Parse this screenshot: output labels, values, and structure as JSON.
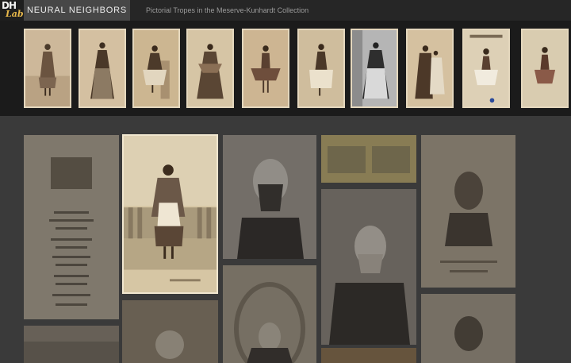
{
  "header": {
    "logo_line1": "DH",
    "logo_line2": "Lab",
    "active_tab": "NEURAL NEIGHBORS",
    "subtitle": "Pictorial Tropes in the Meserve-Kunhardt Collection"
  },
  "neighbors": {
    "count": 10,
    "items": [
      {
        "tone": "#cdb89a"
      },
      {
        "tone": "#d4c0a1"
      },
      {
        "tone": "#ccb691"
      },
      {
        "tone": "#d6c5a5"
      },
      {
        "tone": "#cdb592"
      },
      {
        "tone": "#cfbd9d"
      },
      {
        "tone": "#b5b5b5"
      },
      {
        "tone": "#d5c1a0"
      },
      {
        "tone": "#ddd0b6"
      },
      {
        "tone": "#d9ccb0"
      }
    ]
  },
  "colors": {
    "accent": "#e8b84a",
    "card": "#8f8066",
    "selected_border": "#f0e6cf"
  }
}
